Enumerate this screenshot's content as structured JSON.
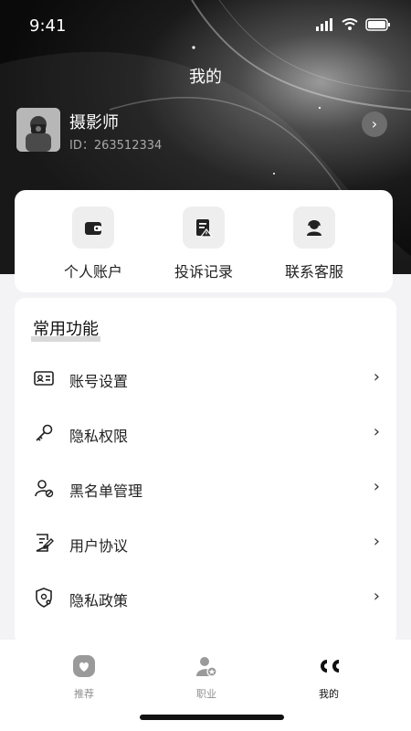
{
  "status": {
    "time": "9:41"
  },
  "header": {
    "title": "我的"
  },
  "profile": {
    "name": "摄影师",
    "id_text": "ID：263512334"
  },
  "quick_actions": [
    {
      "label": "个人账户",
      "icon": "wallet-icon"
    },
    {
      "label": "投诉记录",
      "icon": "complaint-record-icon"
    },
    {
      "label": "联系客服",
      "icon": "customer-service-icon"
    }
  ],
  "common": {
    "title": "常用功能",
    "items": [
      {
        "label": "账号设置",
        "icon": "id-card-icon"
      },
      {
        "label": "隐私权限",
        "icon": "key-icon"
      },
      {
        "label": "黑名单管理",
        "icon": "blocked-user-icon"
      },
      {
        "label": "用户协议",
        "icon": "document-edit-icon"
      },
      {
        "label": "隐私政策",
        "icon": "shield-gear-icon"
      }
    ]
  },
  "tabs": [
    {
      "label": "推荐",
      "icon": "heart-icon"
    },
    {
      "label": "职业",
      "icon": "user-star-icon"
    },
    {
      "label": "我的",
      "icon": "cc-icon"
    }
  ]
}
